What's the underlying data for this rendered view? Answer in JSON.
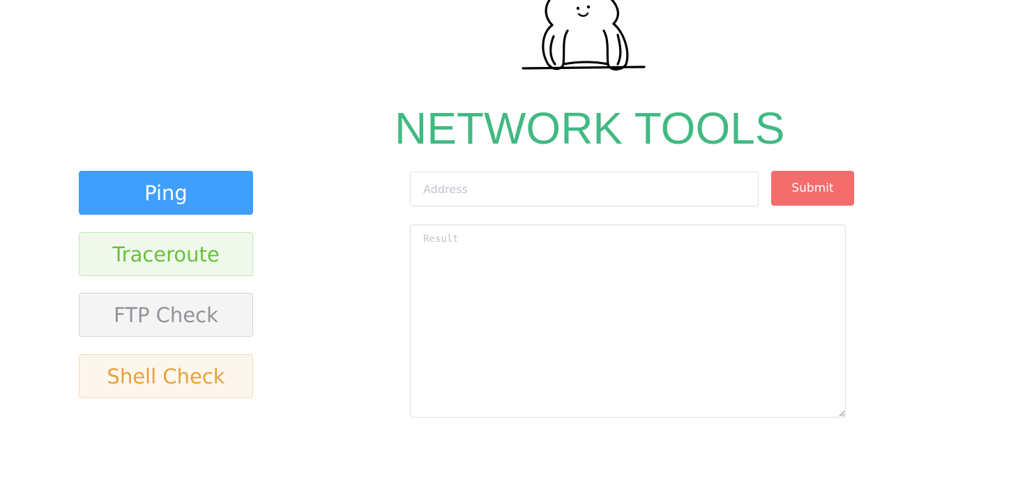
{
  "header": {
    "title": "NETWORK TOOLS",
    "mascot_icon": "mascot-illustration"
  },
  "tools": {
    "ping_label": "Ping",
    "traceroute_label": "Traceroute",
    "ftp_check_label": "FTP Check",
    "shell_check_label": "Shell Check"
  },
  "form": {
    "address_placeholder": "Address",
    "address_value": "",
    "submit_label": "Submit",
    "result_placeholder": "Result",
    "result_value": ""
  },
  "colors": {
    "title": "#42b983",
    "ping": "#409eff",
    "traceroute": "#67c23a",
    "ftp_check": "#909399",
    "shell_check": "#e6a23c",
    "submit": "#f56c6c"
  }
}
